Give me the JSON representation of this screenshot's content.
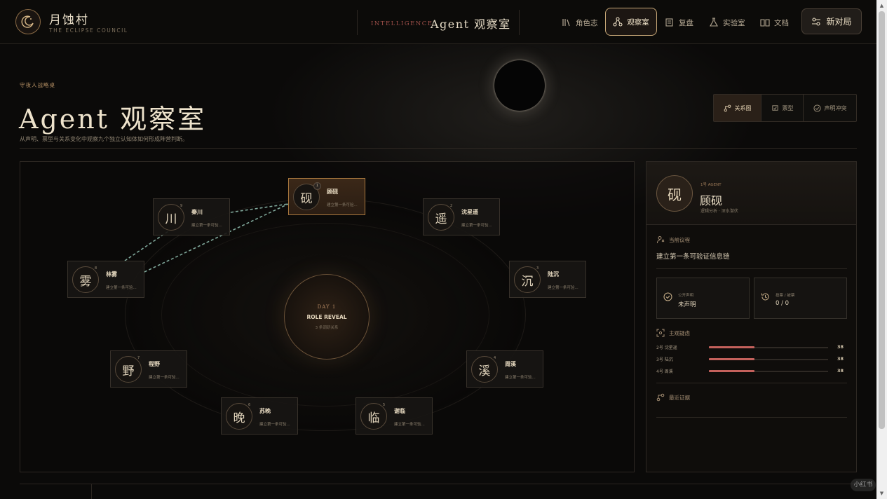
{
  "brand": {
    "title": "月蚀村",
    "subtitle": "THE ECLIPSE COUNCIL"
  },
  "header": {
    "intel_label": "INTELLIGENCE",
    "title": "Agent 观察室"
  },
  "nav": {
    "items": [
      {
        "label": "角色志",
        "icon": "books-icon"
      },
      {
        "label": "观察室",
        "icon": "network-icon",
        "active": true
      },
      {
        "label": "复盘",
        "icon": "replay-icon"
      },
      {
        "label": "实验室",
        "icon": "flask-icon"
      },
      {
        "label": "文档",
        "icon": "book-icon"
      }
    ],
    "new_game": "新对局"
  },
  "page": {
    "kicker": "守夜人战略桌",
    "title": "Agent 观察室",
    "description": "从声明、票型与关系变化中观察九个独立认知体如何形成阵营判断。"
  },
  "view_tabs": [
    {
      "label": "关系图",
      "icon": "relation-icon",
      "active": true
    },
    {
      "label": "票型",
      "icon": "ballot-icon"
    },
    {
      "label": "声明冲突",
      "icon": "check-circle-icon"
    }
  ],
  "graph": {
    "center": {
      "day": "DAY 1",
      "phase": "ROLE REVEAL",
      "sub": "3 条调研关系"
    },
    "nodes": [
      {
        "char": "砚",
        "name": "顾砚",
        "num": "1",
        "status": "建立第一条可验...",
        "active": true
      },
      {
        "char": "遥",
        "name": "沈星遥",
        "num": "2",
        "status": "建立第一条可验..."
      },
      {
        "char": "沉",
        "name": "陆沉",
        "num": "3",
        "status": "建立第一条可验..."
      },
      {
        "char": "溪",
        "name": "周溪",
        "num": "4",
        "status": "建立第一条可验..."
      },
      {
        "char": "临",
        "name": "谢临",
        "num": "5",
        "status": "建立第一条可验..."
      },
      {
        "char": "晚",
        "name": "苏晚",
        "num": "6",
        "status": "建立第一条可验..."
      },
      {
        "char": "野",
        "name": "程野",
        "num": "7",
        "status": "建立第一条可验..."
      },
      {
        "char": "雾",
        "name": "林雾",
        "num": "8",
        "status": "建立第一条可验..."
      },
      {
        "char": "川",
        "name": "秦川",
        "num": "9",
        "status": "建立第一条可验..."
      }
    ]
  },
  "detail": {
    "kicker": "1号 AGENT",
    "avatar": "砚",
    "name": "顾砚",
    "tags": "逻辑分析 · 深水潜伏",
    "agenda_label": "当前议程",
    "agenda": "建立第一条可验证信息链",
    "claim_label": "公开声明",
    "claim_value": "未声明",
    "vote_label": "投票 / 被票",
    "vote_value": "0 / 0",
    "suspicion_label": "主观疑虑",
    "suspicion": [
      {
        "label": "2号 沈星遥",
        "value": 38
      },
      {
        "label": "3号 陆沉",
        "value": 38
      },
      {
        "label": "4号 周溪",
        "value": 38
      }
    ],
    "evidence_label": "最近证据"
  },
  "watermark": "小红书"
}
